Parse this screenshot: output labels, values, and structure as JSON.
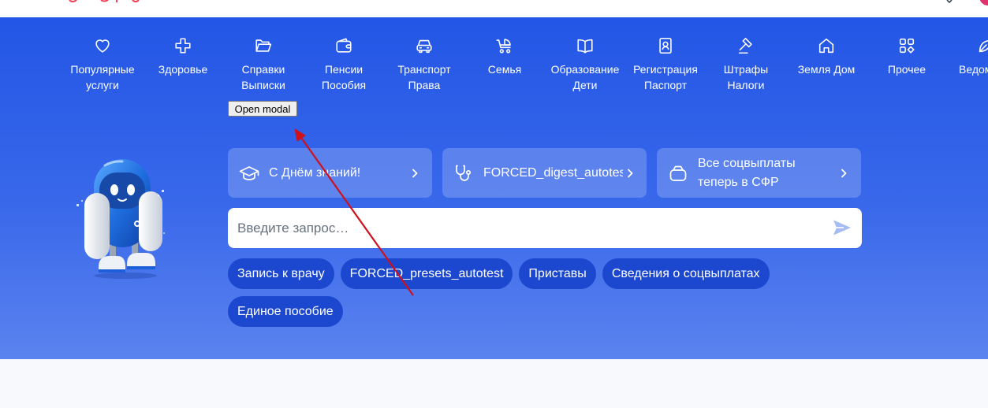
{
  "nav": {
    "items": [
      {
        "icon": "heart-icon",
        "line1": "Популярные",
        "line2": "услуги"
      },
      {
        "icon": "plus-cross-icon",
        "line1": "Здоровье"
      },
      {
        "icon": "folder-icon",
        "line1": "Справки",
        "line2": "Выписки"
      },
      {
        "icon": "wallet-icon",
        "line1": "Пенсии",
        "line2": "Пособия"
      },
      {
        "icon": "car-icon",
        "line1": "Транспорт",
        "line2": "Права"
      },
      {
        "icon": "stroller-icon",
        "line1": "Семья"
      },
      {
        "icon": "book-icon",
        "line1": "Образование",
        "line2": "Дети"
      },
      {
        "icon": "passport-icon",
        "line1": "Регистрация",
        "line2": "Паспорт"
      },
      {
        "icon": "gavel-icon",
        "line1": "Штрафы",
        "line2": "Налоги"
      },
      {
        "icon": "house-icon",
        "line1": "Земля Дом"
      },
      {
        "icon": "grid-icon",
        "line1": "Прочее"
      },
      {
        "icon": "leaf-icon",
        "line1": "Ведом"
      }
    ]
  },
  "modal_button": {
    "label": "Open modal"
  },
  "mascot": {
    "icon": "robot-mascot-icon"
  },
  "feature_cards": [
    {
      "icon": "graduation-cap-icon",
      "text": "С Днём знаний!"
    },
    {
      "icon": "stethoscope-icon",
      "text": "FORCED_digest_autotest"
    },
    {
      "icon": "purse-icon",
      "line1": "Все соцвыплаты",
      "line2": "теперь в СФР"
    }
  ],
  "search": {
    "placeholder": "Введите запрос…",
    "submit_icon": "send-icon"
  },
  "quick_chips": [
    "Запись к врачу",
    "FORCED_presets_autotest",
    "Приставы",
    "Сведения о соцвыплатах",
    "Единое пособие"
  ],
  "colors": {
    "hero_top": "#2356e6",
    "hero_bottom": "#5b83ef",
    "card": "rgba(255,255,255,0.2)",
    "chip": "#1c48cf",
    "page_bg": "#f8f9fd",
    "annotation": "#d0101a",
    "send_icon": "#a4bbf3",
    "brand_pink": "#e0336e"
  }
}
